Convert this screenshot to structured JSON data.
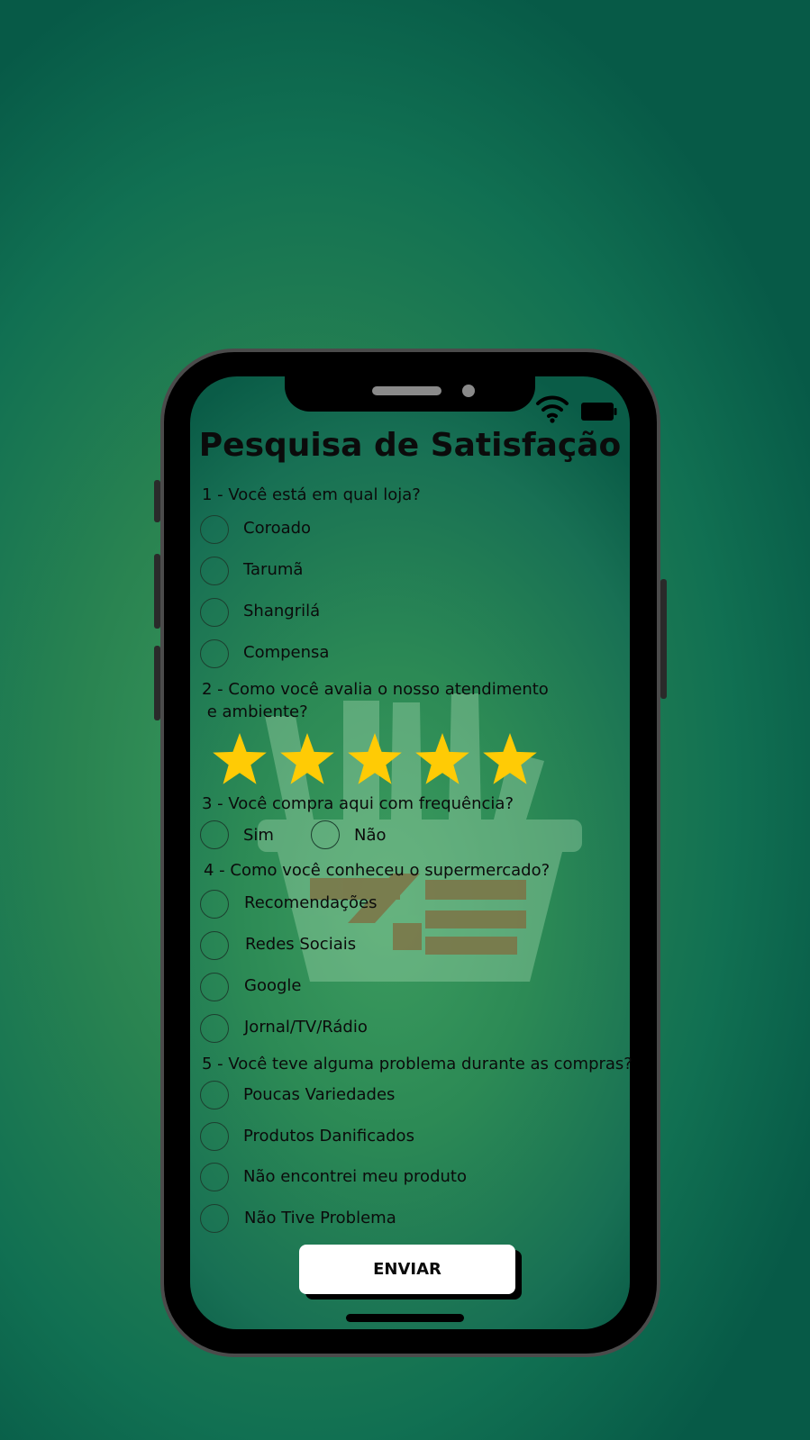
{
  "app": {
    "title": "Pesquisa de Satisfação"
  },
  "status_bar": {
    "icons": [
      "wifi-icon",
      "battery-icon"
    ]
  },
  "colors": {
    "background": "#2a8451",
    "star": "#FFCB05",
    "button": "#FFFFFF",
    "text": "#0B0B0B"
  },
  "questions": {
    "q1": {
      "text": "1 - Você está em qual loja?",
      "options": [
        "Coroado",
        "Tarumã",
        "Shangrilá",
        "Compensa"
      ]
    },
    "q2": {
      "text": "2 - Como você avalia o nosso atendimento\n e ambiente?",
      "rating": 5,
      "max_rating": 5
    },
    "q3": {
      "text": "3 - Você compra aqui com frequência?",
      "options": [
        "Sim",
        "Não"
      ]
    },
    "q4": {
      "text": "4 - Como você conheceu o supermercado?",
      "options": [
        "Recomendações",
        "Redes Sociais",
        "Google",
        "Jornal/TV/Rádio"
      ]
    },
    "q5": {
      "text": "5 - Você teve alguma problema durante as compras?",
      "options": [
        "Poucas Variedades",
        "Produtos Danificados",
        "Não encontrei meu produto",
        "Não Tive Problema"
      ]
    }
  },
  "submit": {
    "label": "ENVIAR"
  }
}
